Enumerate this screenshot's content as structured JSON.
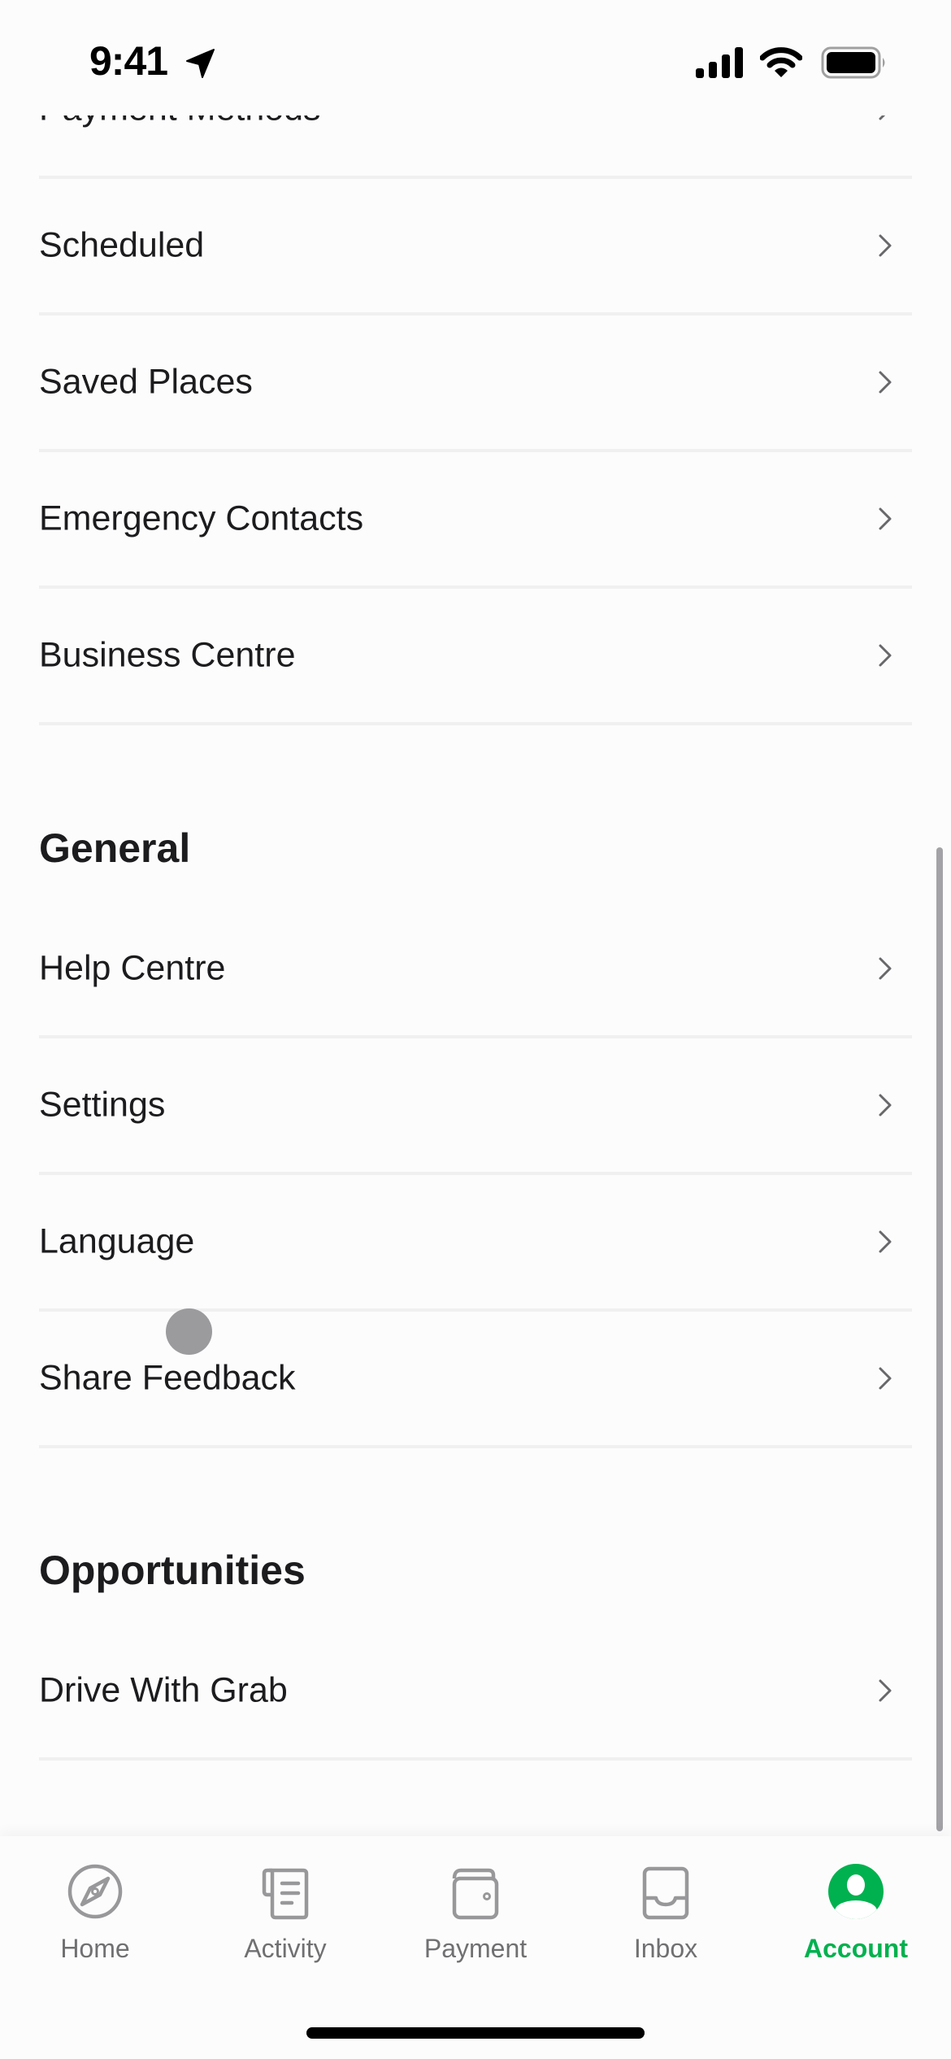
{
  "status_bar": {
    "time": "9:41",
    "icons": [
      "location-arrow-icon",
      "cellular-signal-icon",
      "wifi-icon",
      "battery-icon"
    ]
  },
  "sections": {
    "account_items": [
      {
        "label": "Payment Methods",
        "icon": "chevron-right-icon"
      },
      {
        "label": "Scheduled",
        "icon": "chevron-right-icon"
      },
      {
        "label": "Saved Places",
        "icon": "chevron-right-icon"
      },
      {
        "label": "Emergency Contacts",
        "icon": "chevron-right-icon"
      },
      {
        "label": "Business Centre",
        "icon": "chevron-right-icon"
      }
    ],
    "general": {
      "title": "General",
      "items": [
        {
          "label": "Help Centre",
          "icon": "chevron-right-icon"
        },
        {
          "label": "Settings",
          "icon": "chevron-right-icon"
        },
        {
          "label": "Language",
          "icon": "chevron-right-icon"
        },
        {
          "label": "Share Feedback",
          "icon": "chevron-right-icon"
        }
      ]
    },
    "opportunities": {
      "title": "Opportunities",
      "items": [
        {
          "label": "Drive With Grab",
          "icon": "chevron-right-icon"
        }
      ]
    }
  },
  "tab_bar": {
    "active_color": "#00b14f",
    "inactive_color": "#707072",
    "tabs": [
      {
        "label": "Home",
        "icon": "compass-icon",
        "active": false
      },
      {
        "label": "Activity",
        "icon": "receipt-list-icon",
        "active": false
      },
      {
        "label": "Payment",
        "icon": "wallet-icon",
        "active": false
      },
      {
        "label": "Inbox",
        "icon": "inbox-tray-icon",
        "active": false
      },
      {
        "label": "Account",
        "icon": "user-avatar-icon",
        "active": true
      }
    ]
  }
}
